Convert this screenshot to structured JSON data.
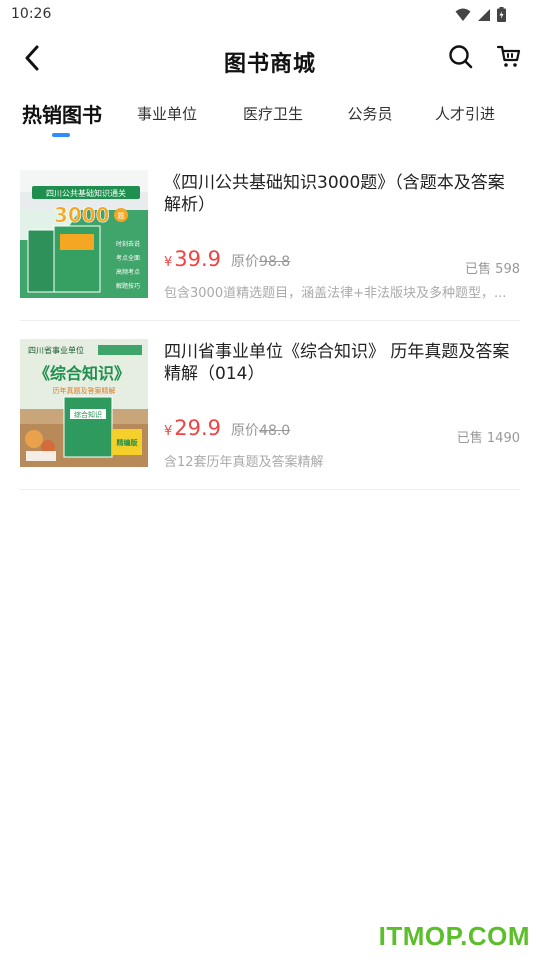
{
  "status_bar": {
    "time": "10:26"
  },
  "header": {
    "title": "图书商城"
  },
  "icons": {
    "back": "back-arrow-icon",
    "search": "search-icon",
    "cart": "cart-icon"
  },
  "tabs": [
    {
      "label": "热销图书",
      "active": true
    },
    {
      "label": "事业单位",
      "active": false
    },
    {
      "label": "医疗卫生",
      "active": false
    },
    {
      "label": "公务员",
      "active": false
    },
    {
      "label": "人才引进",
      "active": false
    }
  ],
  "books": [
    {
      "title": "《四川公共基础知识3000题》（含题本及答案解析）",
      "currency": "¥",
      "price": "39.9",
      "original_label": "原价",
      "original_price": "98.8",
      "sold": "已售 598",
      "desc": "包含3000道精选题目，涵盖法律+非法版块及多种题型，...",
      "cover": {
        "top_label": "四川公共基础知识通关",
        "big_text": "3000",
        "small_text": "题",
        "side_text": [
          "时刻去说",
          "考点全面",
          "高频考点",
          "解题技巧"
        ]
      }
    },
    {
      "title": "四川省事业单位《综合知识》 历年真题及答案精解（014）",
      "currency": "¥",
      "price": "29.9",
      "original_label": "原价",
      "original_price": "48.0",
      "sold": "已售 1490",
      "desc": "含12套历年真题及答案精解",
      "cover": {
        "top_label": "四川省事业单位",
        "big_text": "《综合知识》",
        "sub_text": "历年真题及答案精解",
        "book_label": "综合知识",
        "badge": "精编版"
      }
    }
  ],
  "watermark": "ITMOP.COM",
  "colors": {
    "accent": "#2f8cff",
    "price": "#f04343",
    "watermark": "#5bbf2a",
    "cover_green": "#1e8f4e"
  }
}
